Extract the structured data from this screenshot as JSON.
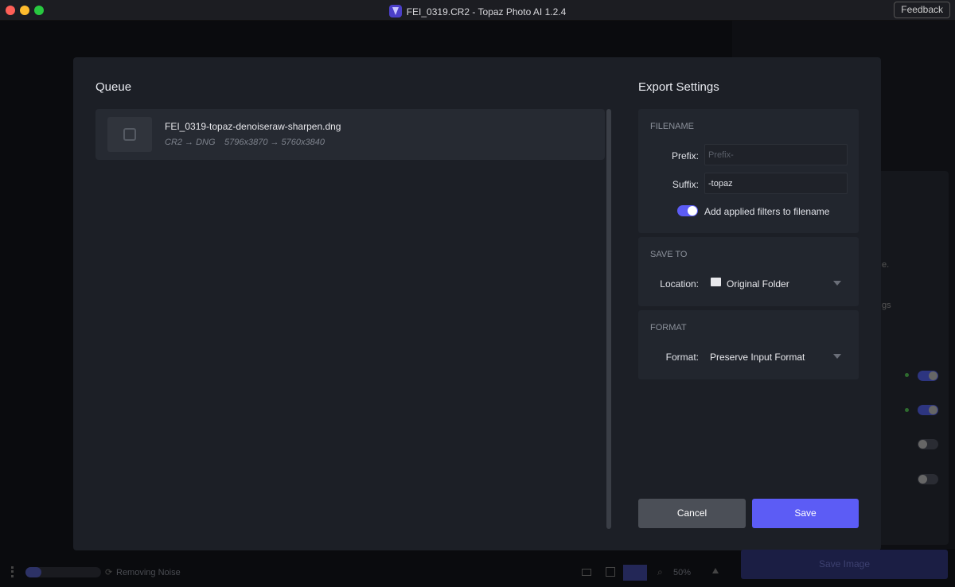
{
  "window": {
    "title": "FEI_0319.CR2 - Topaz Photo AI 1.2.4",
    "feedback_label": "Feedback"
  },
  "queue": {
    "title": "Queue",
    "items": [
      {
        "filename": "FEI_0319-topaz-denoiseraw-sharpen.dng",
        "format_change": "CR2 → DNG",
        "size_change": "5796x3870 → 5760x3840"
      }
    ]
  },
  "export": {
    "title": "Export Settings",
    "filename": {
      "title": "FILENAME",
      "prefix_label": "Prefix:",
      "prefix_placeholder": "Prefix-",
      "prefix_value": "",
      "suffix_label": "Suffix:",
      "suffix_value": "-topaz",
      "toggle_label": "Add applied filters to filename",
      "toggle_on": true
    },
    "save_to": {
      "title": "SAVE TO",
      "location_label": "Location:",
      "location_value": "Original Folder"
    },
    "format": {
      "title": "FORMAT",
      "format_label": "Format:",
      "format_value": "Preserve Input Format"
    },
    "cancel_label": "Cancel",
    "save_label": "Save"
  },
  "background": {
    "status_text": "Removing Noise",
    "zoom": "50%",
    "save_image_label": "Save Image",
    "partial_text_1": "e.",
    "partial_text_2": "gs"
  },
  "colors": {
    "accent": "#5c5cf5",
    "modal_bg": "#1c1f26",
    "panel_bg": "#22262e"
  }
}
